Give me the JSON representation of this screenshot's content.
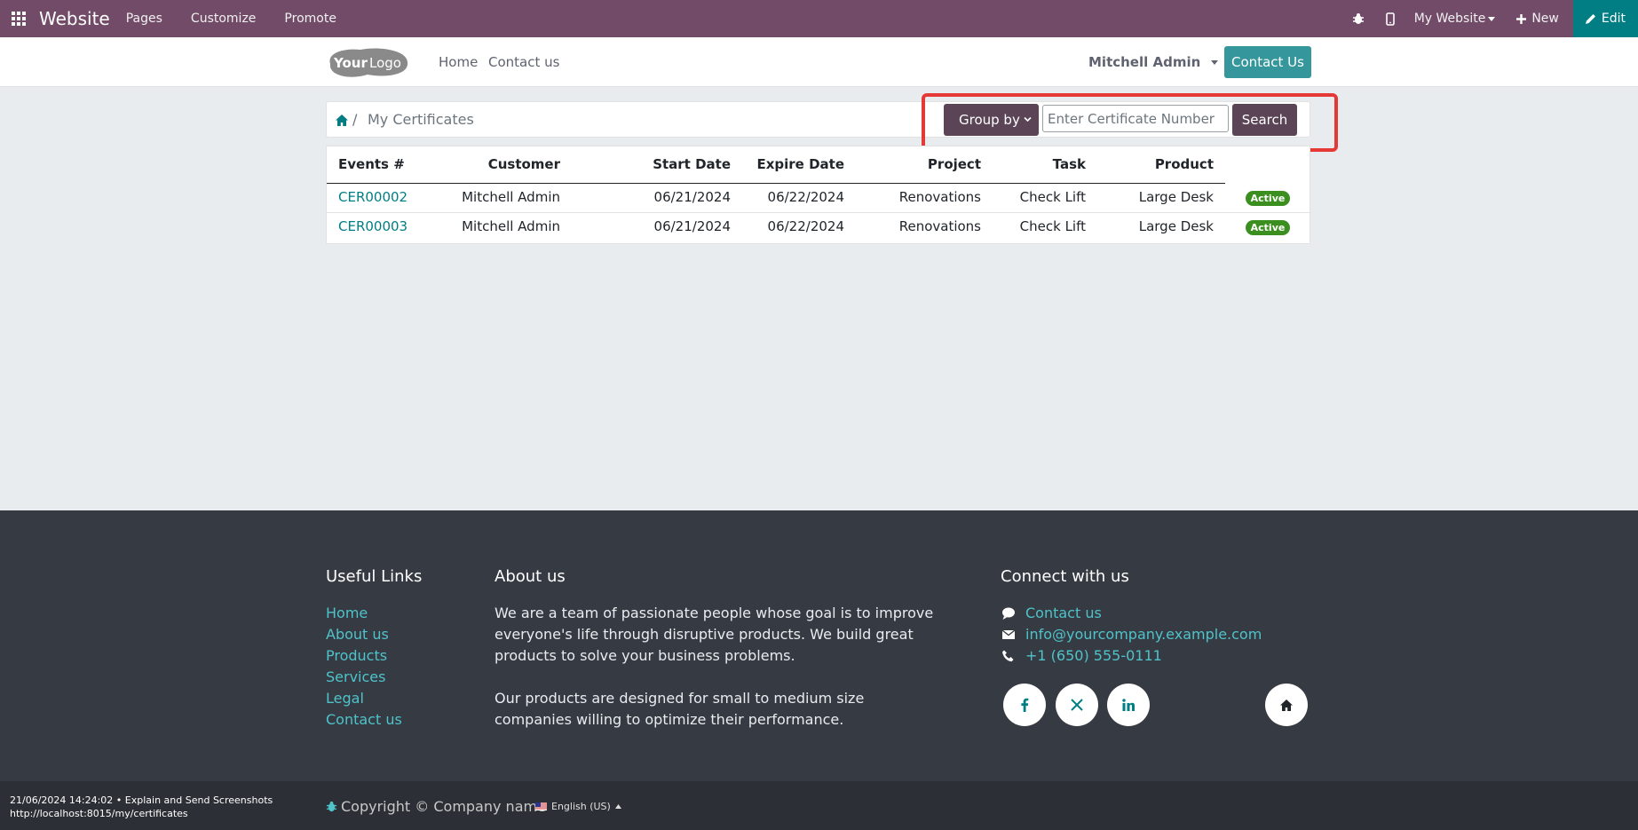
{
  "topbar": {
    "brand": "Website",
    "nav": [
      "Pages",
      "Customize",
      "Promote"
    ],
    "site_switcher": "My Website",
    "new_label": "New",
    "edit_label": "Edit"
  },
  "header": {
    "logo_alt": "YourLogo",
    "nav": [
      "Home",
      "Contact us"
    ],
    "user": "Mitchell Admin",
    "contact_button": "Contact Us"
  },
  "breadcrumb": {
    "separator": "/",
    "current": "My Certificates"
  },
  "search": {
    "group_by_label": "Group by",
    "placeholder": "Enter Certificate Number",
    "button_label": "Search"
  },
  "table": {
    "columns": [
      "Events #",
      "Customer",
      "Start Date",
      "Expire Date",
      "Project",
      "Task",
      "Product"
    ],
    "rows": [
      {
        "event": "CER00002",
        "customer": "Mitchell Admin",
        "start": "06/21/2024",
        "expire": "06/22/2024",
        "project": "Renovations",
        "task": "Check Lift",
        "product": "Large Desk",
        "status": "Active"
      },
      {
        "event": "CER00003",
        "customer": "Mitchell Admin",
        "start": "06/21/2024",
        "expire": "06/22/2024",
        "project": "Renovations",
        "task": "Check Lift",
        "product": "Large Desk",
        "status": "Active"
      }
    ]
  },
  "footer": {
    "useful_links_title": "Useful Links",
    "useful_links": [
      "Home",
      "About us",
      "Products",
      "Services",
      "Legal",
      "Contact us"
    ],
    "about_title": "About us",
    "about_lines_1": [
      "We are a team of passionate people whose goal is to improve",
      "everyone's life through disruptive products. We build great",
      "products to solve your business problems."
    ],
    "about_lines_2": [
      "Our products are designed for small to medium size",
      "companies willing to optimize their performance."
    ],
    "connect_title": "Connect with us",
    "contact_link": "Contact us",
    "email": "info@yourcompany.example.com",
    "phone": "+1 (650) 555-0111",
    "socials": [
      "facebook-icon",
      "x-icon",
      "linkedin-icon",
      "home-icon"
    ]
  },
  "bottom": {
    "timestamp_line": "21/06/2024 14:24:02 • Explain and Send Screenshots",
    "url_line": "http://localhost:8015/my/certificates",
    "copyright": "Copyright © Company name",
    "language": "English (US)"
  },
  "colors": {
    "topbar": "#714b67",
    "accent": "#017e84",
    "contact_button": "#35979c",
    "search_buttons": "#5a4456",
    "highlight": "#e53935",
    "badge_active": "#3b8f1e",
    "footer": "#363a42",
    "footer_link": "#4fc3ca"
  }
}
